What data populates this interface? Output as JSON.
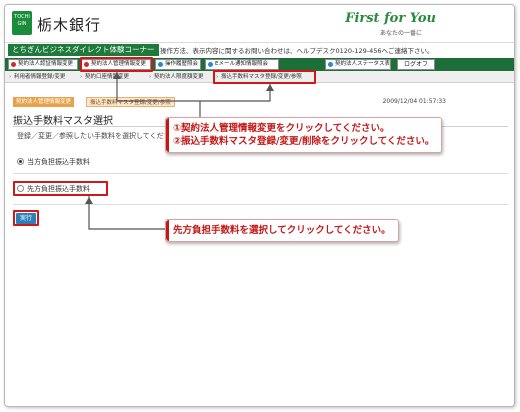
{
  "header": {
    "logo_text": "TOCHI GIN",
    "bank_name": "栃木銀行",
    "brand_slogan": "First for You",
    "brand_tagline": "あなたの一番に"
  },
  "banner": {
    "corner_title": "とちぎんビジネスダイレクト体験コーナー",
    "contact_text": "操作方法、表示内容に関するお問い合わせは、ヘルプデスク0120-129-456へご連絡下さい。"
  },
  "menubar": {
    "items": [
      {
        "label": "契約法人認証情報変更"
      },
      {
        "label": "契約法人管理情報変更"
      },
      {
        "label": "操作履歴照会"
      },
      {
        "label": "Eメール通知情報照会"
      },
      {
        "label": "契約法人ステータス表示"
      }
    ],
    "logout_label": "ログオフ"
  },
  "submenu": {
    "items": [
      {
        "label": "利用者情報登録/変更"
      },
      {
        "label": "契約口座情報変更"
      },
      {
        "label": "契約法人限度額変更"
      },
      {
        "label": "振込手数料マスタ登録/変更/参照"
      }
    ]
  },
  "breadcrumb": {
    "first": "契約法人管理情報変更",
    "second": "振込手数料マスタ登録/変更/参照"
  },
  "timestamp": "2009/12/04  01:57:33",
  "page": {
    "title": "振込手数料マスタ選択",
    "instruction": "登録／変更／参照したい手数料を選択してください。",
    "options": [
      {
        "label": "当方負担振込手数料",
        "checked": true
      },
      {
        "label": "先方負担振込手数料",
        "checked": false
      }
    ],
    "execute_label": "実行"
  },
  "callouts": {
    "top_line1": "①契約法人管理情報変更をクリックしてください。",
    "top_line2": "②振込手数料マスタ登録/変更/削除をクリックしてください。",
    "bottom": "先方負担手数料を選択してクリックしてください。"
  },
  "colors": {
    "brand_green": "#1d7a3b",
    "menu_green": "#1e6e3a",
    "highlight_red": "#d01818",
    "callout_red": "#c31818",
    "button_blue": "#2d7fb8"
  }
}
